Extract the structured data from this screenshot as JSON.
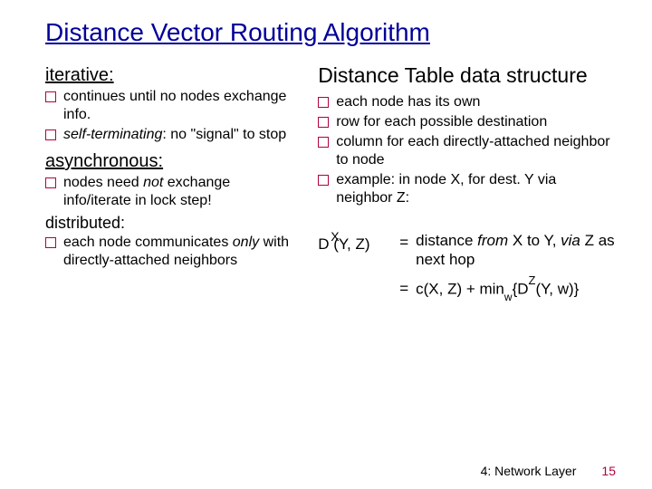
{
  "title": "Distance Vector Routing Algorithm",
  "left": {
    "iterative": {
      "heading": "iterative:",
      "items": [
        {
          "pre": "continues until no nodes exchange info."
        },
        {
          "em": "self-terminating",
          "post": ": no \"signal\" to stop"
        }
      ]
    },
    "asynchronous": {
      "heading": "asynchronous:",
      "item0_pre": "nodes need ",
      "item0_em": "not",
      "item0_post": " exchange info/iterate in lock step!",
      "distributed_heading": "distributed:",
      "item1_pre": "each node communicates ",
      "item1_em": "only",
      "item1_post": " with directly-attached neighbors"
    }
  },
  "right": {
    "heading": "Distance Table data structure",
    "items": [
      "each node has its own",
      "row for each possible destination",
      "column for each directly-attached neighbor to node",
      "example: in node X, for dest. Y via neighbor Z:"
    ],
    "formula": {
      "lhs_base": "D (Y, Z)",
      "lhs_sup": "X",
      "eq": "=",
      "rhs1_pre": "distance ",
      "rhs1_em1": "from",
      "rhs1_mid": " X to Y, ",
      "rhs1_em2": "via",
      "rhs1_post": " Z as next hop",
      "rhs2_a": "c(X, Z) + min",
      "rhs2_sub": "w",
      "rhs2_b": "{D",
      "rhs2_sup": "Z",
      "rhs2_c": "(Y, w)}"
    }
  },
  "footer": {
    "chapter": "4: Network Layer",
    "page": "15"
  }
}
